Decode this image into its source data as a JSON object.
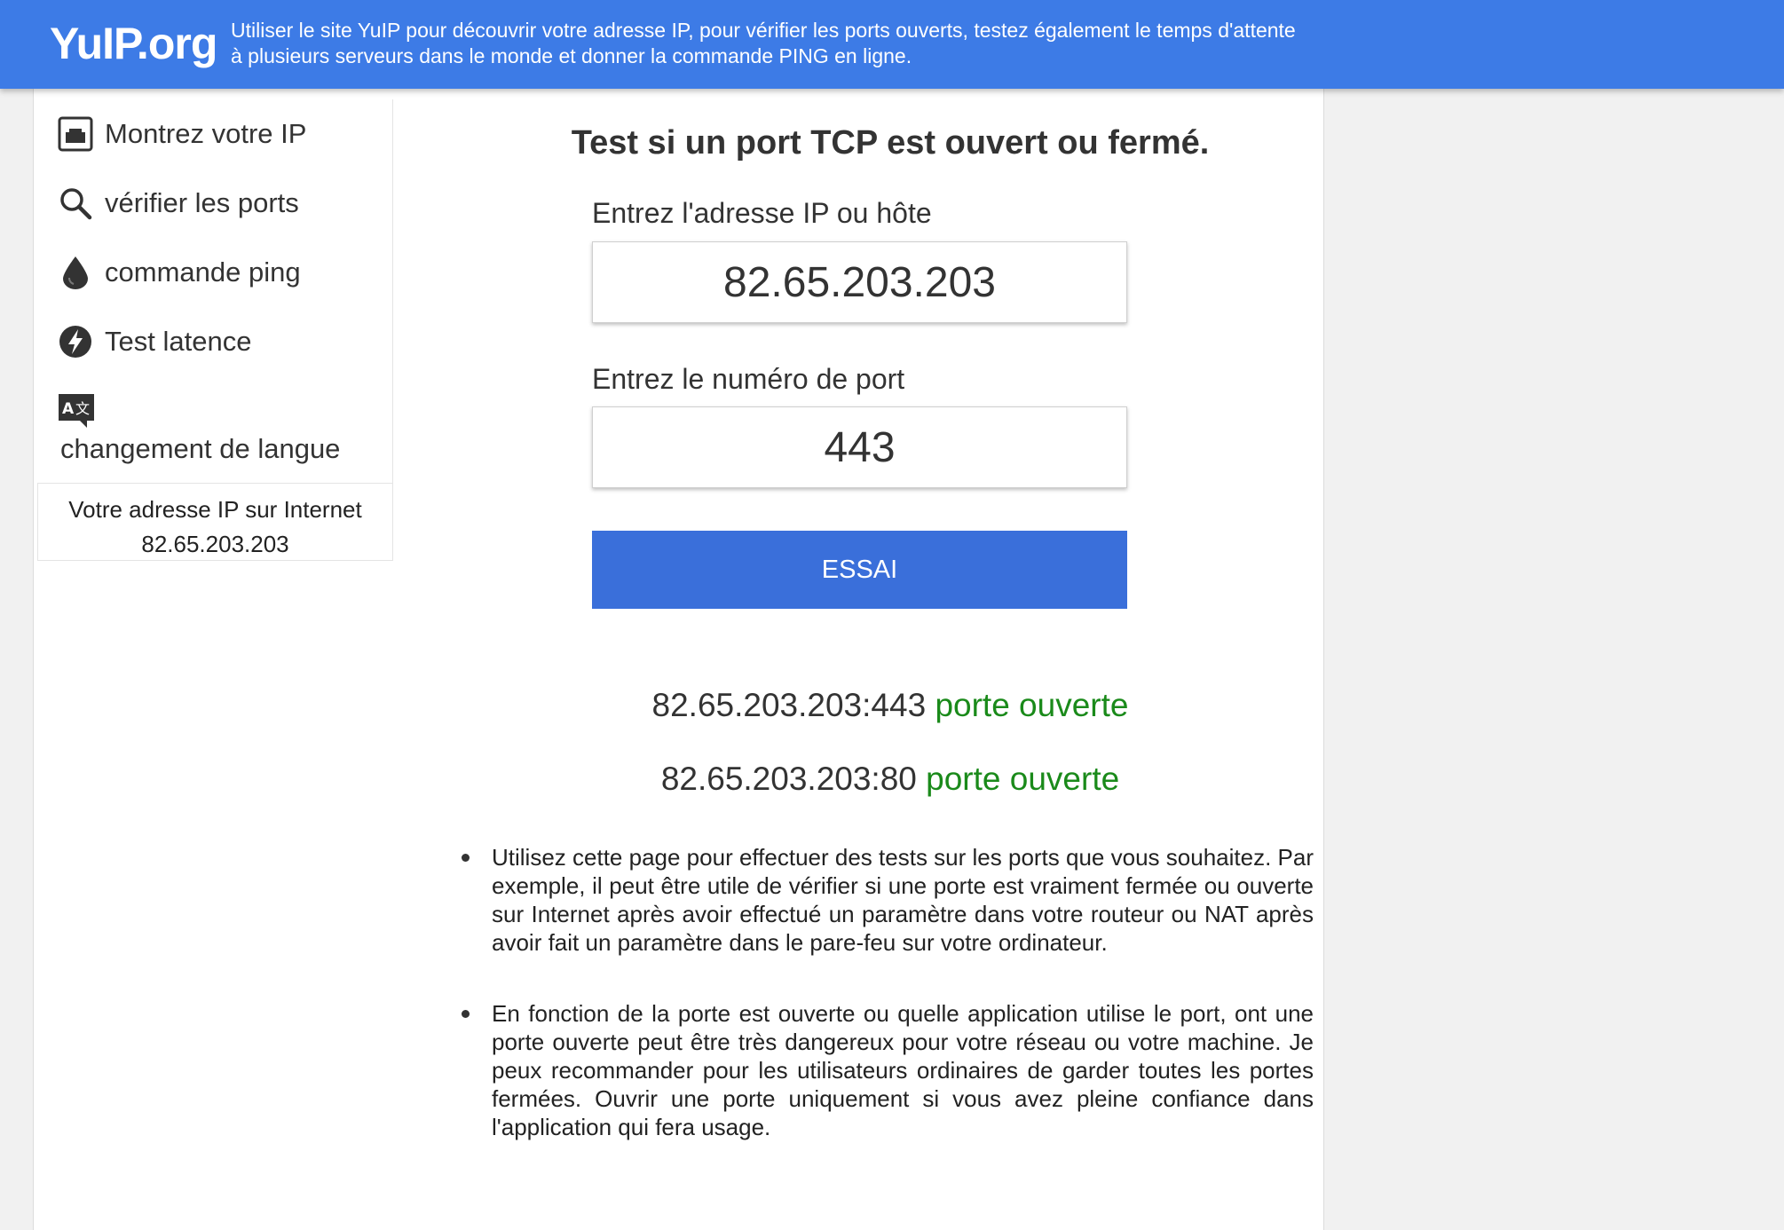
{
  "header": {
    "logo": "YuIP.org",
    "tagline": "Utiliser le site YuIP pour découvrir votre adresse IP, pour vérifier les ports ouverts, testez également le temps d'attente à plusieurs serveurs dans le monde et donner la commande PING en ligne."
  },
  "sidebar": {
    "items": [
      {
        "label": "Montrez votre IP",
        "icon": "network-port-icon"
      },
      {
        "label": "vérifier les ports",
        "icon": "magnifier-icon"
      },
      {
        "label": "commande ping",
        "icon": "water-drop-icon"
      },
      {
        "label": "Test latence",
        "icon": "lightning-icon"
      }
    ],
    "language": {
      "label": "changement de langue",
      "icon": "translate-icon"
    },
    "ip_box": {
      "title": "Votre adresse IP sur Internet",
      "ip": "82.65.203.203"
    }
  },
  "main": {
    "title": "Test si un port TCP est ouvert ou fermé.",
    "ip_label": "Entrez l'adresse IP ou hôte",
    "ip_value": "82.65.203.203",
    "port_label": "Entrez le numéro de port",
    "port_value": "443",
    "button": "ESSAI",
    "results": [
      {
        "address": "82.65.203.203:443",
        "status": "porte ouverte"
      },
      {
        "address": "82.65.203.203:80",
        "status": "porte ouverte"
      }
    ],
    "info": [
      "Utilisez cette page pour effectuer des tests sur les ports que vous souhaitez. Par exemple, il peut être utile de vérifier si une porte est vraiment fermée ou ouverte sur Internet après avoir effectué un paramètre dans votre routeur ou NAT après avoir fait un paramètre dans le pare-feu sur votre ordinateur.",
      "En fonction de la porte est ouverte ou quelle application utilise le port, ont une porte ouverte peut être très dangereux pour votre réseau ou votre machine. Je peux recommander pour les utilisateurs ordinaires de garder toutes les portes fermées. Ouvrir une porte uniquement si vous avez pleine confiance dans l'application qui fera usage."
    ]
  },
  "colors": {
    "header_bg": "#3d7be6",
    "button_bg": "#3a6fda",
    "status_green": "#1a8a1a"
  }
}
